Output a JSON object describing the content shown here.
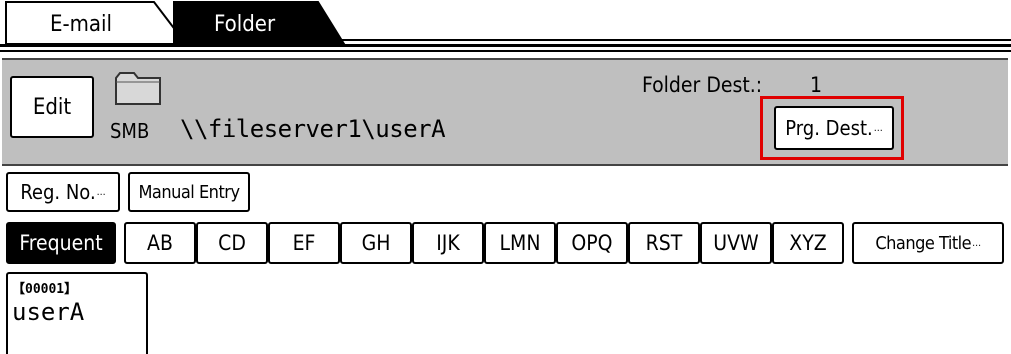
{
  "tabs": [
    {
      "label": "E-mail",
      "active": false
    },
    {
      "label": "Folder",
      "active": true
    }
  ],
  "destination": {
    "edit_label": "Edit",
    "protocol": "SMB",
    "path": "\\\\fileserver1\\userA",
    "count_label": "Folder Dest.:",
    "count": "1",
    "prg_label": "Prg. Dest."
  },
  "row2": {
    "reg_no_label": "Reg. No.",
    "manual_entry_label": "Manual Entry"
  },
  "index_tabs": [
    "Frequent",
    "AB",
    "CD",
    "EF",
    "GH",
    "IJK",
    "LMN",
    "OPQ",
    "RST",
    "UVW",
    "XYZ",
    "Change Title"
  ],
  "entries": [
    {
      "number": "【00001】",
      "name": "userA"
    }
  ],
  "colors": {
    "panel": "#bfbfbf",
    "highlight": "#e00000",
    "active_tab": "#000000"
  }
}
